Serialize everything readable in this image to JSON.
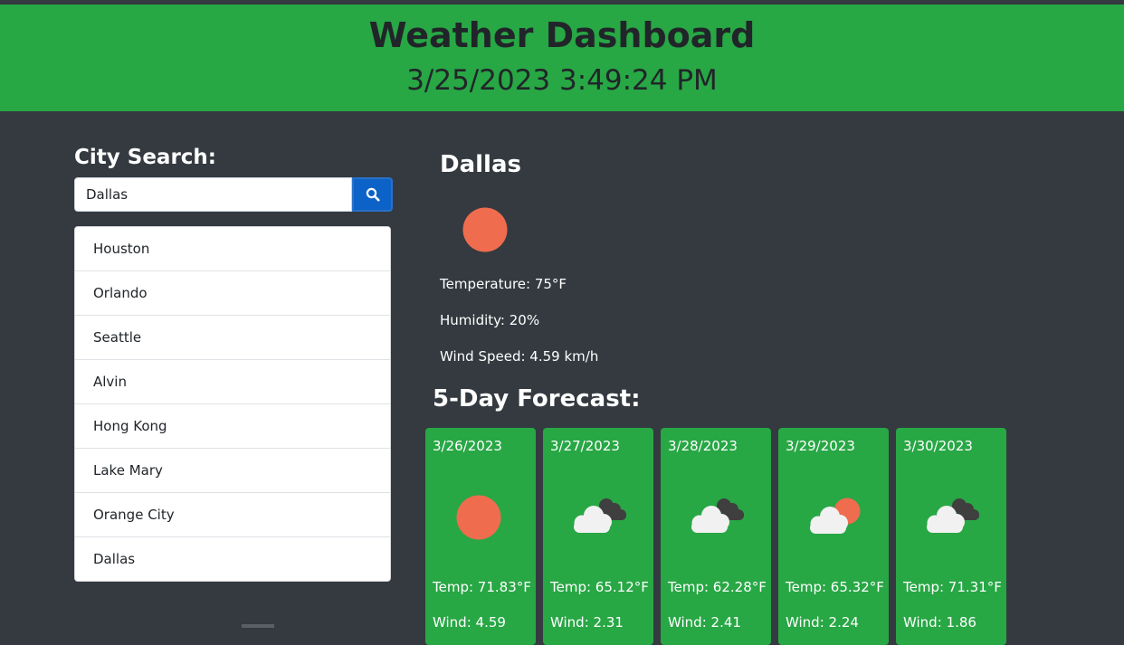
{
  "header": {
    "title": "Weather Dashboard",
    "datetime": "3/25/2023 3:49:24 PM"
  },
  "search": {
    "title": "City Search:",
    "value": "Dallas",
    "button_icon": "search-icon"
  },
  "history": [
    "Houston",
    "Orlando",
    "Seattle",
    "Alvin",
    "Hong Kong",
    "Lake Mary",
    "Orange City",
    "Dallas"
  ],
  "current": {
    "city": "Dallas",
    "icon": "sun-icon",
    "temperature": "Temperature: 75°F",
    "humidity": "Humidity: 20%",
    "wind": "Wind Speed: 4.59 km/h"
  },
  "forecast": {
    "title": "5-Day Forecast:",
    "days": [
      {
        "date": "3/26/2023",
        "icon": "sun-icon",
        "temp": "Temp: 71.83°F",
        "wind": "Wind: 4.59"
      },
      {
        "date": "3/27/2023",
        "icon": "cloudy-icon",
        "temp": "Temp: 65.12°F",
        "wind": "Wind: 2.31"
      },
      {
        "date": "3/28/2023",
        "icon": "cloudy-icon",
        "temp": "Temp: 62.28°F",
        "wind": "Wind: 2.41"
      },
      {
        "date": "3/29/2023",
        "icon": "partly-cloudy-icon",
        "temp": "Temp: 65.32°F",
        "wind": "Wind: 2.24"
      },
      {
        "date": "3/30/2023",
        "icon": "cloudy-icon",
        "temp": "Temp: 71.31°F",
        "wind": "Wind: 1.86"
      }
    ]
  },
  "colors": {
    "header_bg": "#28a745",
    "page_bg": "#343a40",
    "sun": "#ef6c4f",
    "button": "#0d62c7"
  }
}
